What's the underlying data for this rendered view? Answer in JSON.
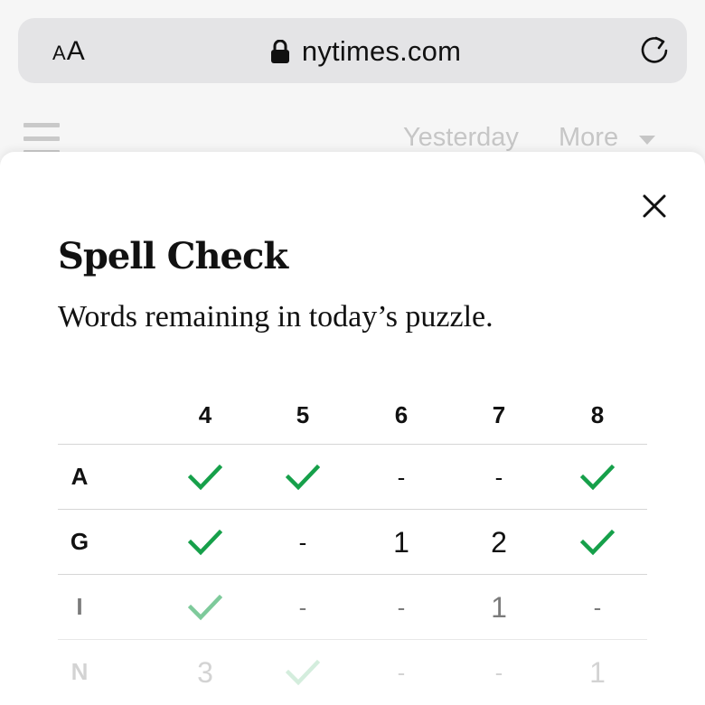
{
  "browser": {
    "aa_label_small": "A",
    "aa_label_big": "A",
    "url": "nytimes.com"
  },
  "page_behind": {
    "nav_items": [
      "Yesterday",
      "More"
    ]
  },
  "modal": {
    "title": "Spell Check",
    "subtitle": "Words remaining in today’s puzzle.",
    "columns": [
      "4",
      "5",
      "6",
      "7",
      "8"
    ],
    "rows": [
      {
        "letter": "A",
        "cells": [
          "check",
          "check",
          "-",
          "-",
          "check"
        ]
      },
      {
        "letter": "G",
        "cells": [
          "check",
          "-",
          "1",
          "2",
          "check"
        ]
      },
      {
        "letter": "I",
        "cells": [
          "check",
          "-",
          "-",
          "1",
          "-"
        ]
      },
      {
        "letter": "N",
        "cells": [
          "3",
          "check",
          "-",
          "-",
          "1"
        ]
      }
    ]
  },
  "colors": {
    "check": "#16a04a",
    "text": "#111111",
    "muted": "#c6c6c6",
    "address_bar": "#e4e4e6"
  }
}
